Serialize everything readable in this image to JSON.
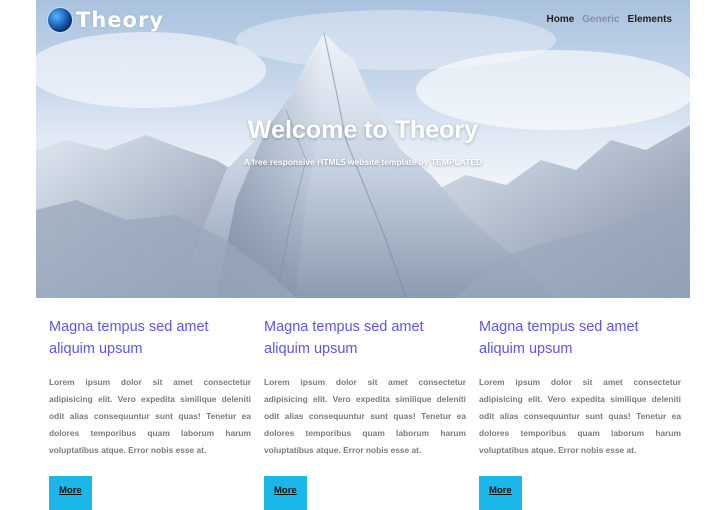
{
  "header": {
    "logo_text": "Theory",
    "logo_icon": "globe-logo-icon",
    "nav": [
      {
        "label": "Home",
        "active": true
      },
      {
        "label": "Generic",
        "active": false
      },
      {
        "label": "Elements",
        "active": false
      }
    ]
  },
  "hero": {
    "title": "Welcome to Theory",
    "subtitle": "A free responsive HTML5 website template by TEMPLATED"
  },
  "features": [
    {
      "title": "Magna tempus sed amet aliquim upsum",
      "text": "Lorem ipsum dolor sit amet consectetur adipisicing elit. Vero expedita similique deleniti odit alias consequuntur sunt quas! Tenetur ea dolores temporibus quam laborum harum voluptatibus atque. Error nobis esse at.",
      "button": "More"
    },
    {
      "title": "Magna tempus sed amet aliquim upsum",
      "text": "Lorem ipsum dolor sit amet consectetur adipisicing elit. Vero expedita similique deleniti odit alias consequuntur sunt quas! Tenetur ea dolores temporibus quam laborum harum voluptatibus atque. Error nobis esse at.",
      "button": "More"
    },
    {
      "title": "Magna tempus sed amet aliquim upsum",
      "text": "Lorem ipsum dolor sit amet consectetur adipisicing elit. Vero expedita similique deleniti odit alias consequuntur sunt quas! Tenetur ea dolores temporibus quam laborum harum voluptatibus atque. Error nobis esse at.",
      "button": "More"
    }
  ],
  "colors": {
    "accent_title": "#5d56e6",
    "button_bg": "#1ab7e8",
    "body_text": "#7b7b7b"
  }
}
